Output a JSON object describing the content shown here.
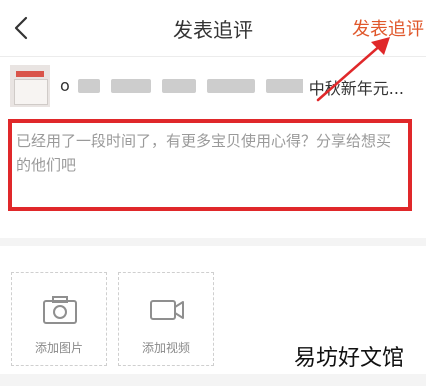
{
  "header": {
    "back_icon": "chevron-left-icon",
    "title": "发表追评",
    "submit_label": "发表追评",
    "accent_color": "#e0582c"
  },
  "product": {
    "title_prefix": "o",
    "title_suffix": "中秋新年元..."
  },
  "comment": {
    "placeholder": "已经用了一段时间了，有更多宝贝使用心得？分享给想买的他们吧",
    "highlight_color": "#e0282a"
  },
  "media": {
    "photo": {
      "icon": "camera-icon",
      "label": "添加图片"
    },
    "video": {
      "icon": "video-camera-icon",
      "label": "添加视频"
    }
  },
  "watermark": "易坊好文馆",
  "annotation": {
    "icon": "arrow-icon",
    "color": "#e0282a"
  }
}
